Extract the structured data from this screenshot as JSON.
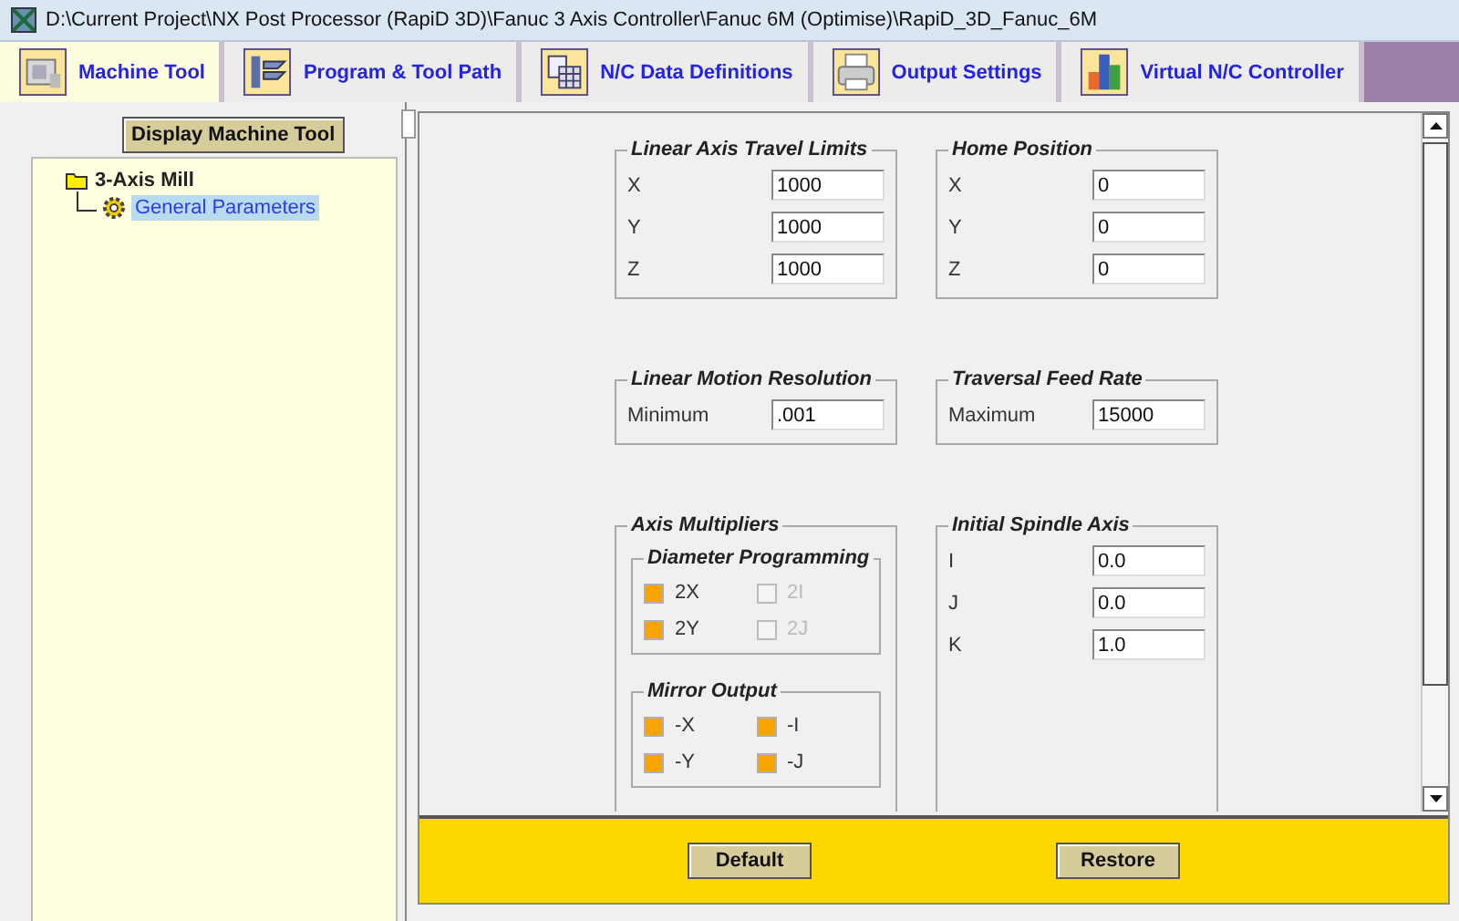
{
  "window": {
    "title": "D:\\Current Project\\NX Post Processor (RapiD 3D)\\Fanuc 3 Axis Controller\\Fanuc 6M (Optimise)\\RapiD_3D_Fanuc_6M"
  },
  "tabs": [
    {
      "label": "Machine Tool",
      "selected": true,
      "kind": "machine"
    },
    {
      "label": "Program & Tool Path",
      "selected": false,
      "kind": "program"
    },
    {
      "label": "N/C Data Definitions",
      "selected": false,
      "kind": "table"
    },
    {
      "label": "Output Settings",
      "selected": false,
      "kind": "printer"
    },
    {
      "label": "Virtual N/C Controller",
      "selected": false,
      "kind": "chart"
    }
  ],
  "sidebar": {
    "button": "Display Machine Tool",
    "tree": [
      {
        "label": "3-Axis Mill",
        "children": [
          {
            "label": "General Parameters",
            "selected": true
          }
        ]
      }
    ]
  },
  "groups": [
    {
      "kind": "fields",
      "title": "Linear Axis Travel Limits",
      "rows": [
        {
          "label": "X",
          "value": "1000"
        },
        {
          "label": "Y",
          "value": "1000"
        },
        {
          "label": "Z",
          "value": "1000"
        }
      ]
    },
    {
      "kind": "fields",
      "title": "Home Position",
      "rows": [
        {
          "label": "X",
          "value": "0"
        },
        {
          "label": "Y",
          "value": "0"
        },
        {
          "label": "Z",
          "value": "0"
        }
      ]
    },
    {
      "kind": "fields",
      "title": "Linear Motion Resolution",
      "rows": [
        {
          "label": "Minimum",
          "value": ".001"
        }
      ]
    },
    {
      "kind": "fields",
      "title": "Traversal Feed Rate",
      "rows": [
        {
          "label": "Maximum",
          "value": "15000"
        }
      ]
    },
    {
      "kind": "checks",
      "title": "Axis Multipliers",
      "subgroups": [
        {
          "title": "Diameter Programming",
          "checkboxes": [
            {
              "label": "2X",
              "checked": true,
              "disabled": false
            },
            {
              "label": "2I",
              "checked": false,
              "disabled": true
            },
            {
              "label": "2Y",
              "checked": true,
              "disabled": false
            },
            {
              "label": "2J",
              "checked": false,
              "disabled": true
            }
          ]
        },
        {
          "title": "Mirror Output",
          "checkboxes": [
            {
              "label": "-X",
              "checked": true,
              "disabled": false
            },
            {
              "label": "-I",
              "checked": true,
              "disabled": false
            },
            {
              "label": "-Y",
              "checked": true,
              "disabled": false
            },
            {
              "label": "-J",
              "checked": true,
              "disabled": false
            }
          ]
        }
      ]
    },
    {
      "kind": "fields",
      "title": "Initial Spindle Axis",
      "rows": [
        {
          "label": "I",
          "value": "0.0"
        },
        {
          "label": "J",
          "value": "0.0"
        },
        {
          "label": "K",
          "value": "1.0"
        }
      ]
    }
  ],
  "footer": {
    "buttons": [
      "Default",
      "Restore"
    ]
  }
}
